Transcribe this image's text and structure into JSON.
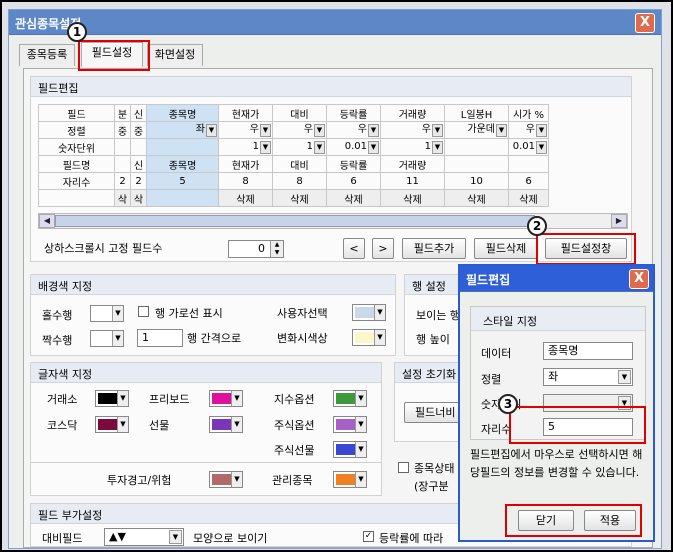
{
  "window": {
    "title": "관심종목설정",
    "close": "X"
  },
  "tabs": [
    "종목등록",
    "필드설정",
    "화면설정"
  ],
  "field_edit": {
    "title": "필드편집",
    "rows": [
      [
        "필드",
        "분",
        "신",
        "종목명",
        "현재가",
        "대비",
        "등락률",
        "거래량",
        "L일봉H",
        "시가 %"
      ],
      [
        "정렬",
        "중",
        "중",
        "좌",
        "우",
        "우",
        "우",
        "우",
        "가운데",
        "우"
      ],
      [
        "숫자단위",
        "",
        "",
        "",
        "1",
        "1",
        "0.01",
        "1",
        "",
        "0.01"
      ],
      [
        "필드명",
        "",
        "신",
        "종목명",
        "현재가",
        "대비",
        "등락률",
        "거래량",
        "",
        ""
      ],
      [
        "자리수",
        "2",
        "2",
        "5",
        "8",
        "8",
        "6",
        "11",
        "10",
        "6"
      ],
      [
        "",
        "삭",
        "삭",
        "",
        "삭제",
        "삭제",
        "삭제",
        "삭제",
        "삭제",
        "삭제"
      ]
    ],
    "fixed_label": "상하스크롤시 고정 필드수",
    "fixed_value": "0",
    "prev": "<",
    "next": ">",
    "add": "필드추가",
    "delete": "필드삭제",
    "settings": "필드설정창"
  },
  "bg": {
    "title": "배경색 지정",
    "odd": "홀수행",
    "even": "짝수행",
    "row_line": "행 가로선 표시",
    "spacing_value": "1",
    "spacing_label": "행 간격으로",
    "user_select": "사용자선택",
    "change_color": "변화시색상"
  },
  "row_settings": {
    "title": "행 설정",
    "visible": "보이는 행",
    "height": "행 높이"
  },
  "font_color": {
    "title": "글자색 지정",
    "items": [
      {
        "label": "거래소",
        "color": "#000000"
      },
      {
        "label": "프리보드",
        "color": "#e0109e"
      },
      {
        "label": "지수옵션",
        "color": "#3c9a3c"
      },
      {
        "label": "코스닥",
        "color": "#7b0a3a"
      },
      {
        "label": "선물",
        "color": "#7a35b8"
      },
      {
        "label": "주식옵션",
        "color": "#a860c8"
      },
      {
        "label": "주식선물",
        "color": "#3848d0"
      },
      {
        "label": "투자경고/위험",
        "color": "#b06a6a"
      },
      {
        "label": "관리종목",
        "color": "#f08020"
      }
    ]
  },
  "reset": {
    "title": "설정 초기화",
    "button": "필드너비"
  },
  "status": {
    "label": "종목상태",
    "sub": "(장구분"
  },
  "extra": {
    "title": "필드 부가설정",
    "compare": "대비필드",
    "compare_value": "▲▼",
    "shape": "모양으로 보이기",
    "rate": "등락률에 따라"
  },
  "dialog": {
    "title": "필드편집",
    "style_title": "스타일 지정",
    "data_label": "데이터",
    "data_value": "종목명",
    "align_label": "정렬",
    "align_value": "좌",
    "unit_label": "숫자단위",
    "digits_label": "자리수",
    "digits_value": "5",
    "help": "필드편집에서 마우스로 선택하시면 해당필드의 정보를 변경할 수 있습니다.",
    "close": "닫기",
    "apply": "적용"
  },
  "markers": [
    "1",
    "2",
    "3"
  ]
}
